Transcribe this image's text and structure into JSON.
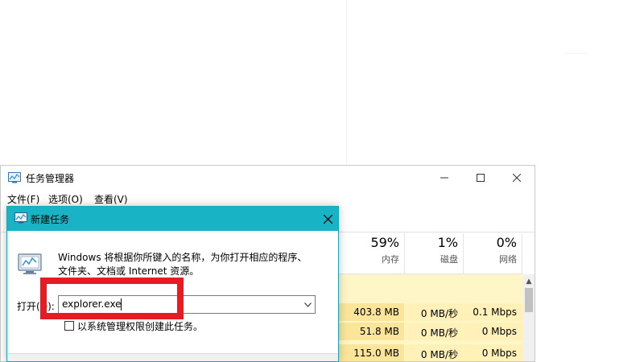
{
  "task_manager": {
    "title": "任务管理器",
    "menu": [
      "文件(F)",
      "选项(O)",
      "查看(V)"
    ],
    "columns": [
      {
        "percent": "59%",
        "name": "内存"
      },
      {
        "percent": "1%",
        "name": "磁盘"
      },
      {
        "percent": "0%",
        "name": "网络"
      }
    ],
    "rows": [
      {
        "memory": "403.8 MB",
        "disk": "0 MB/秒",
        "network": "0.1 Mbps"
      },
      {
        "memory": "51.8 MB",
        "disk": "0 MB/秒",
        "network": "0 Mbps"
      },
      {
        "memory": "115.0 MB",
        "disk": "0 MB/秒",
        "network": "0 Mbps"
      }
    ]
  },
  "dialog": {
    "title": "新建任务",
    "description_line1": "Windows 将根据你所键入的名称，为你打开相应的程序、",
    "description_line2": "文件夹、文档或 Internet 资源。",
    "open_label": "打开(O):",
    "open_value": "explorer.exe",
    "admin_checkbox_label": "以系统管理权限创建此任务。"
  },
  "colors": {
    "dialog_title_bar": "#18b3c4",
    "annotation": "#e41c23",
    "memory_highlight": "#fbe59a"
  }
}
